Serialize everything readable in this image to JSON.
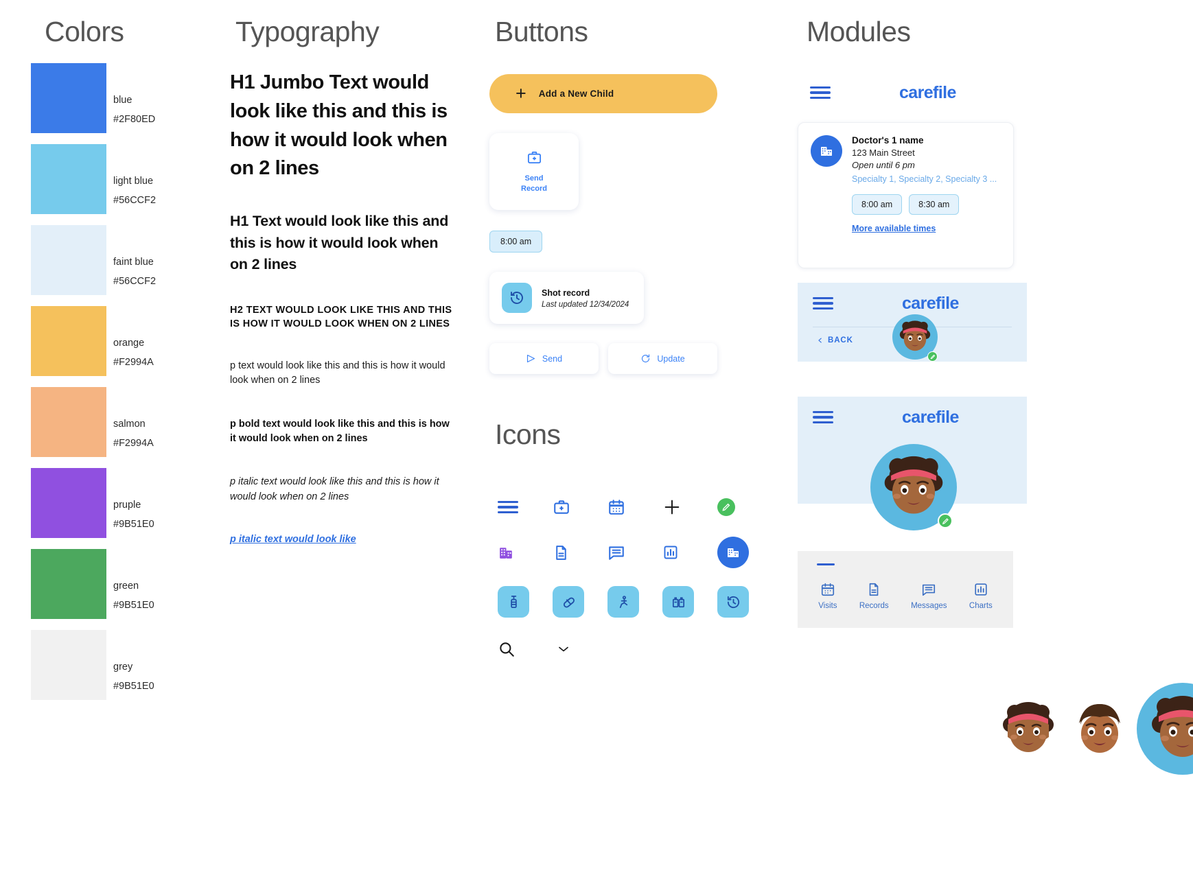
{
  "sections": {
    "colors_title": "Colors",
    "typography_title": "Typography",
    "buttons_title": "Buttons",
    "icons_title": "Icons",
    "modules_title": "Modules"
  },
  "colors": [
    {
      "name": "blue",
      "hex": "#2F80ED",
      "swatch": "#3B7BE8"
    },
    {
      "name": "light blue",
      "hex": "#56CCF2",
      "swatch": "#76CBEC"
    },
    {
      "name": "faint blue",
      "hex": "#56CCF2",
      "swatch": "#E3EFF9"
    },
    {
      "name": "orange",
      "hex": "#F2994A",
      "swatch": "#F5C15C"
    },
    {
      "name": "salmon",
      "hex": "#F2994A",
      "swatch": "#F5B482"
    },
    {
      "name": "pruple",
      "hex": "#9B51E0",
      "swatch": "#9050E0"
    },
    {
      "name": "green",
      "hex": "#9B51E0",
      "swatch": "#4CA85E"
    },
    {
      "name": "grey",
      "hex": "#9B51E0",
      "swatch": "#F1F1F1"
    }
  ],
  "typography": {
    "h1_jumbo": "H1 Jumbo Text would look like this and this is how it would look when on 2 lines",
    "h1": "H1 Text would look like this and this is how it would look when on 2 lines",
    "h2": "H2 Text would look like this and this is how it would look when on 2 lines",
    "p": "p text would look like this and this is how it would look when on 2 lines",
    "p_bold": "p bold text would look like this and this is how it would look when on 2 lines",
    "p_italic": "p italic text would look like this and this is how it would look when on 2 lines",
    "link": "p italic text would look like"
  },
  "buttons": {
    "primary_label": "Add a New Child",
    "tile_label_line1": "Send",
    "tile_label_line2": "Record",
    "time_chip": "8:00 am",
    "record_title": "Shot record",
    "record_subtitle": "Last updated 12/34/2024",
    "ghost_send": "Send",
    "ghost_update": "Update"
  },
  "icons": {
    "row1": [
      "hamburger-menu-icon",
      "medical-kit-add-icon",
      "calendar-icon",
      "plus-icon",
      "edit-pencil-circle-icon"
    ],
    "row2": [
      "building-purple-icon",
      "document-icon",
      "message-icon",
      "chart-bar-icon",
      "building-circle-icon"
    ],
    "row3": [
      "vaccine-tile-icon",
      "pill-tile-icon",
      "allergy-tile-icon",
      "records-tile-icon",
      "history-tile-icon"
    ],
    "row4": [
      "search-icon",
      "chevron-down-icon"
    ],
    "avatars": [
      "avatar-girl-curly",
      "avatar-boy",
      "avatar-girl-editable"
    ]
  },
  "modules": {
    "brand": "carefile",
    "doctor_card": {
      "name": "Doctor's  1 name",
      "address": "123 Main Street",
      "hours": "Open until 6 pm",
      "specialties": "Specialty 1, Specialty 2, Specialty 3 ...",
      "slots": [
        "8:00 am",
        "8:30 am"
      ],
      "more_link": "More available times"
    },
    "back_label": "BACK",
    "bottom_nav": [
      {
        "label": "Visits",
        "icon": "calendar-icon"
      },
      {
        "label": "Records",
        "icon": "document-icon"
      },
      {
        "label": "Messages",
        "icon": "message-icon"
      },
      {
        "label": "Charts",
        "icon": "chart-bar-icon"
      }
    ]
  }
}
